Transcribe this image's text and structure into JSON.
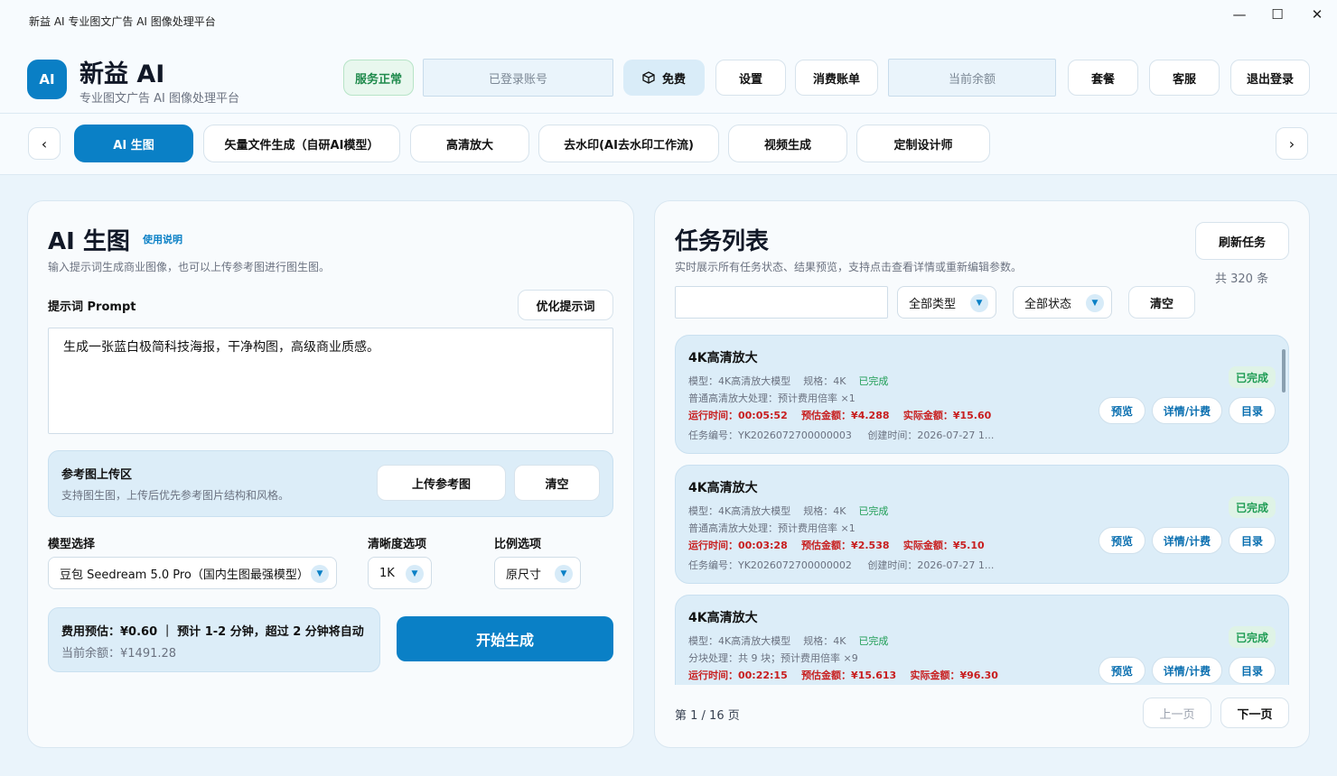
{
  "window": {
    "title": "新益 AI  专业图文广告 AI 图像处理平台",
    "minimize": "—",
    "maximize": "☐",
    "close": "✕"
  },
  "header": {
    "logo_text": "AI",
    "brand": "新益 AI",
    "brand_sub": "专业图文广告 AI 图像处理平台",
    "service_status": "服务正常",
    "account_placeholder": "已登录账号",
    "plan": "免费",
    "settings": "设置",
    "bills": "消费账单",
    "balance_placeholder": "当前余额",
    "packages": "套餐",
    "support": "客服",
    "logout": "退出登录"
  },
  "nav": {
    "prev": "‹",
    "next": "›",
    "tabs": [
      "AI 生图",
      "矢量文件生成（自研AI模型）",
      "高清放大",
      "去水印(AI去水印工作流)",
      "视频生成",
      "定制设计师"
    ]
  },
  "left": {
    "title": "AI 生图",
    "help_link": "使用说明",
    "subtitle": "输入提示词生成商业图像，也可以上传参考图进行图生图。",
    "prompt_label": "提示词 Prompt",
    "optimize_button": "优化提示词",
    "prompt_value": "生成一张蓝白极简科技海报，干净构图，高级商业质感。",
    "ref_title": "参考图上传区",
    "ref_desc": "支持图生图，上传后优先参考图片结构和风格。",
    "upload_button": "上传参考图",
    "clear_button": "清空",
    "model_label": "模型选择",
    "model_value": "豆包 Seedream 5.0 Pro（国内生图最强模型）",
    "clarity_label": "清晰度选项",
    "clarity_value": "1K",
    "ratio_label": "比例选项",
    "ratio_value": "原尺寸",
    "cost_line": "费用预估：¥0.60 ｜ 预计 1-2 分钟，超过 2 分钟将自动",
    "balance_line": "当前余额：¥1491.28",
    "generate_button": "开始生成"
  },
  "right": {
    "title": "任务列表",
    "subtitle": "实时展示所有任务状态、结果预览，支持点击查看详情或重新编辑参数。",
    "refresh_button": "刷新任务",
    "total": "共 320 条",
    "search_value": "",
    "type_filter": "全部类型",
    "status_filter": "全部状态",
    "clear_button": "清空",
    "tasks": [
      {
        "title": "4K高清放大",
        "model": "模型：4K高清放大模型",
        "spec": "规格：4K",
        "status": "已完成",
        "process": "普通高清放大处理：预计费用倍率 ×1",
        "runtime": "运行时间：00:05:52",
        "estimate": "预估金额：¥4.288",
        "actual": "实际金额：¥15.60",
        "task_id": "任务编号：YK2026072700000003",
        "created": "创建时间：2026-07-27 1...",
        "badge": "已完成",
        "preview": "预览",
        "detail": "详情/计费",
        "folder": "目录"
      },
      {
        "title": "4K高清放大",
        "model": "模型：4K高清放大模型",
        "spec": "规格：4K",
        "status": "已完成",
        "process": "普通高清放大处理：预计费用倍率 ×1",
        "runtime": "运行时间：00:03:28",
        "estimate": "预估金额：¥2.538",
        "actual": "实际金额：¥5.10",
        "task_id": "任务编号：YK2026072700000002",
        "created": "创建时间：2026-07-27 1...",
        "badge": "已完成",
        "preview": "预览",
        "detail": "详情/计费",
        "folder": "目录"
      },
      {
        "title": "4K高清放大",
        "model": "模型：4K高清放大模型",
        "spec": "规格：4K",
        "status": "已完成",
        "process": "分块处理：共 9 块；预计费用倍率 ×9",
        "runtime": "运行时间：00:22:15",
        "estimate": "预估金额：¥15.613",
        "actual": "实际金额：¥96.30",
        "task_id": "",
        "created": "",
        "badge": "已完成",
        "preview": "预览",
        "detail": "详情/计费",
        "folder": "目录"
      }
    ],
    "page_info": "第 1 / 16 页",
    "prev_page": "上一页",
    "next_page": "下一页"
  },
  "colors": {
    "accent": "#0a80c6",
    "success": "#1f9d55",
    "danger": "#c81e1e"
  }
}
